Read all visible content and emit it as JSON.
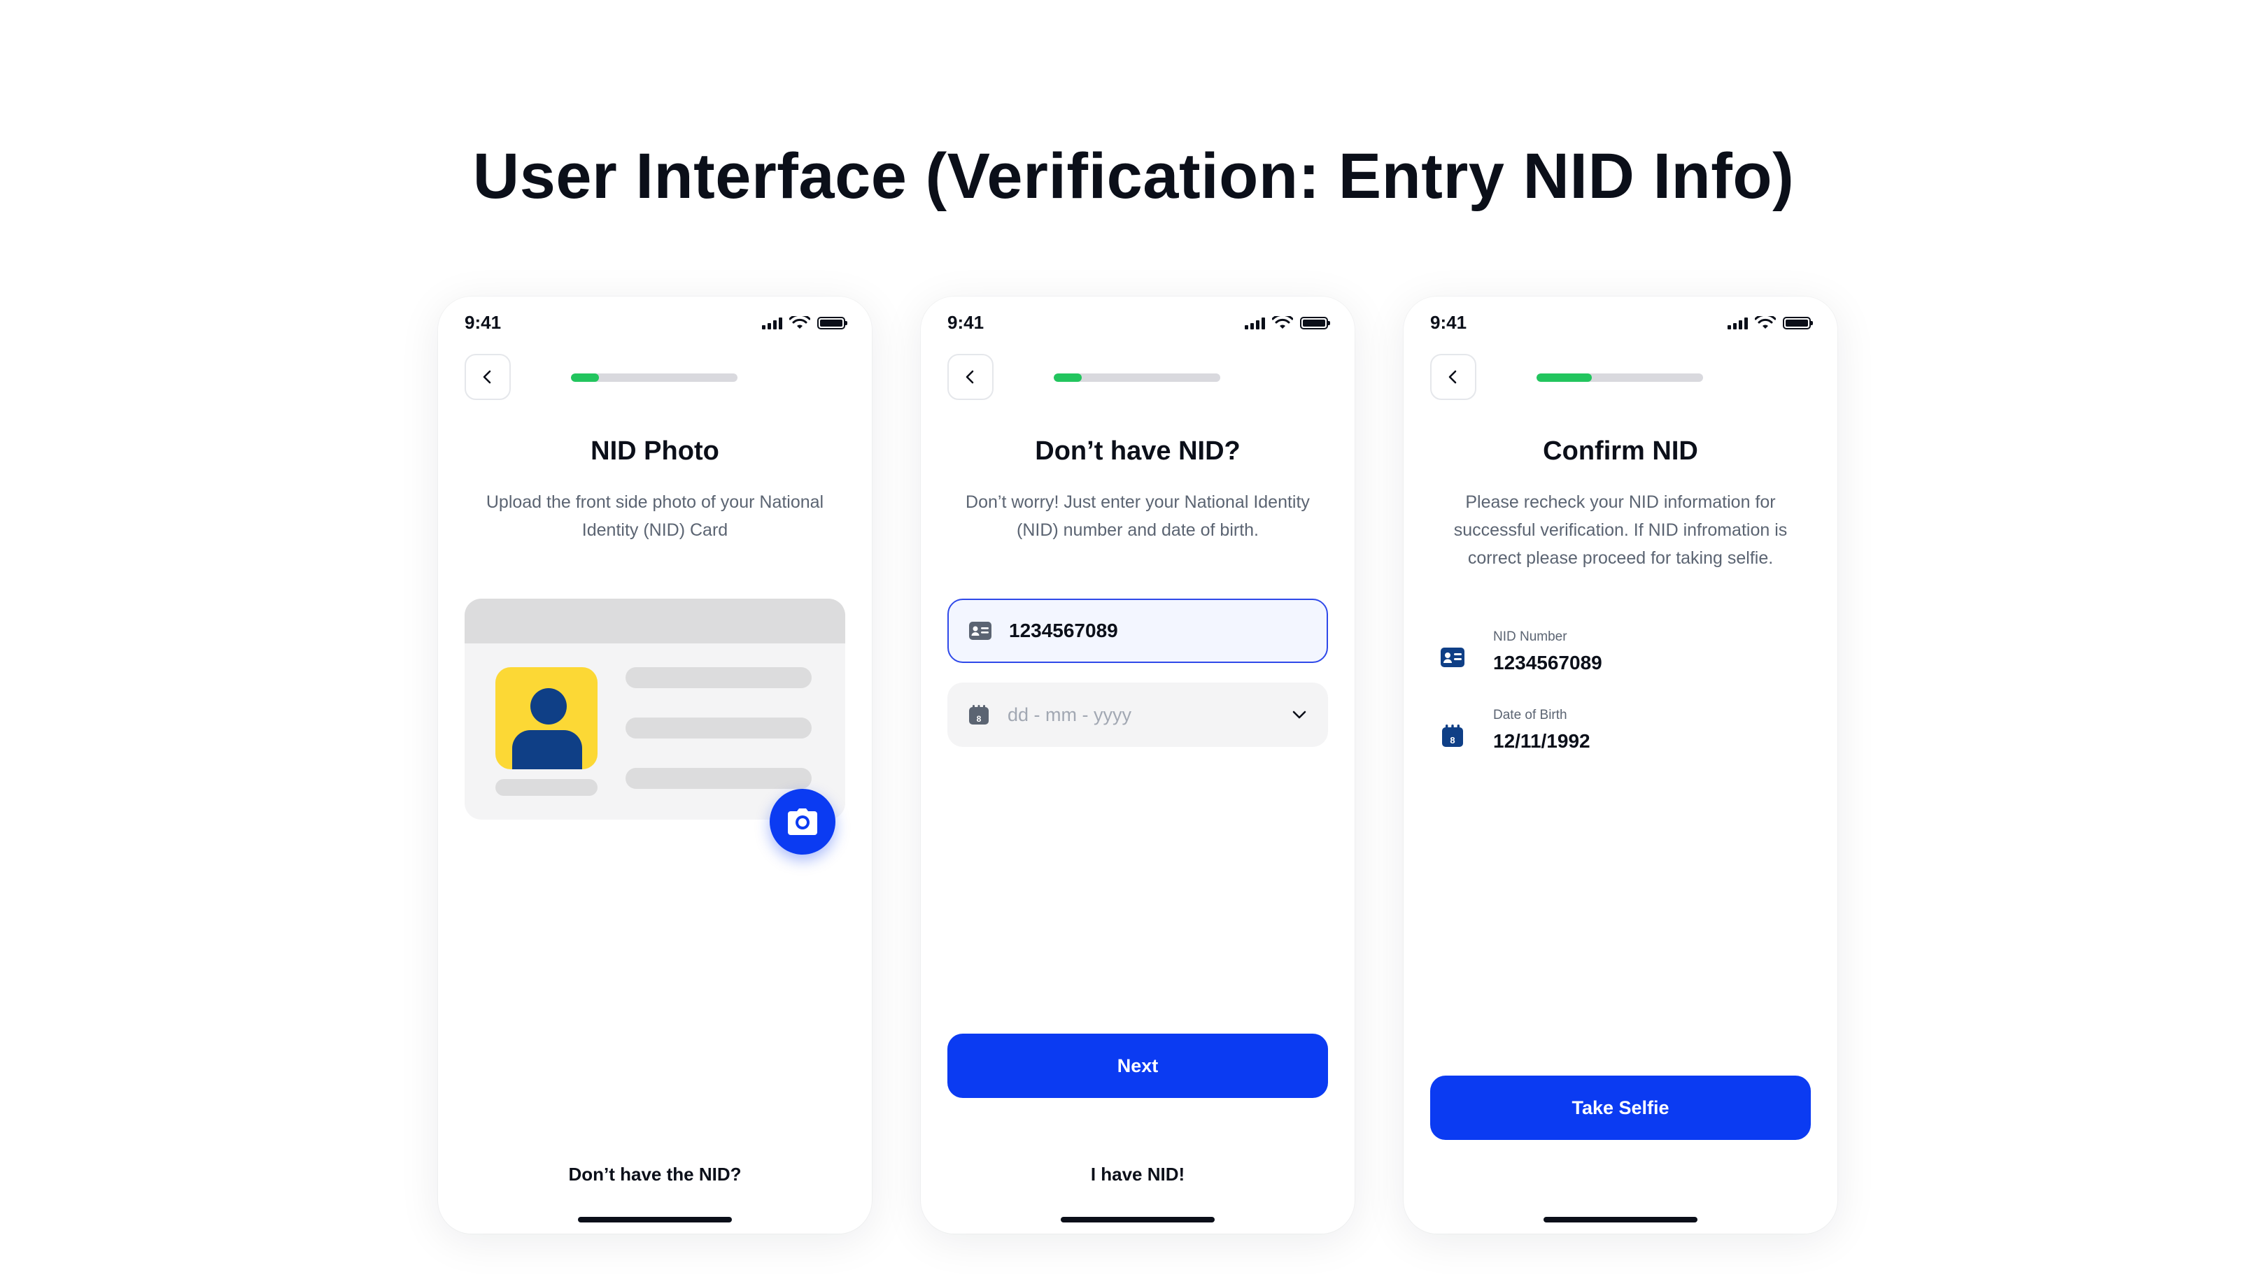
{
  "page_title": "User Interface (Verification: Entry NID Info)",
  "status_time": "9:41",
  "screens": [
    {
      "progress": 0.17,
      "title": "NID Photo",
      "description": "Upload the front side photo of your National Identity (NID) Card",
      "bottom_link": "Don’t have the NID?"
    },
    {
      "progress": 0.17,
      "title": "Don’t have NID?",
      "description": "Don’t worry! Just enter your National Identity (NID) number and date of birth.",
      "nid_input_value": "1234567089",
      "dob_placeholder": "dd - mm - yyyy",
      "next_button": "Next",
      "bottom_link": "I have NID!"
    },
    {
      "progress": 0.33,
      "title": "Confirm NID",
      "description": "Please recheck your NID information for successful verification. If NID infromation is correct please proceed for taking selfie.",
      "nid_number_label": "NID Number",
      "nid_number_value": "1234567089",
      "dob_label": "Date of Birth",
      "dob_value": "12/11/1992",
      "selfie_button": "Take Selfie"
    }
  ],
  "calendar_icon_day": "8",
  "colors": {
    "primary": "#0b3bf2",
    "progress_fill": "#22c55e",
    "avatar_bg": "#fcd835",
    "avatar_figure": "#0f3f86"
  }
}
